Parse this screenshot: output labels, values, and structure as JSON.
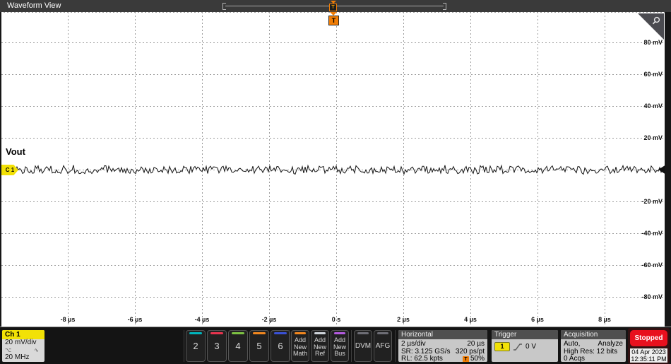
{
  "window": {
    "title": "Waveform View"
  },
  "colors": {
    "accent_orange": "#f07d05",
    "channel_yellow": "#f2e106",
    "stopped_red": "#e8101e",
    "grid_line": "#9b9b9b",
    "trace": "#141414"
  },
  "graticule": {
    "y_labels": [
      "80 mV",
      "60 mV",
      "40 mV",
      "20 mV",
      "-20 mV",
      "-40 mV",
      "-60 mV",
      "-80 mV"
    ],
    "x_labels": [
      "-8 µs",
      "-6 µs",
      "-4 µs",
      "-2 µs",
      "0 s",
      "2 µs",
      "4 µs",
      "6 µs",
      "8 µs"
    ],
    "volts_per_div": "20 mV/div",
    "time_per_div": "2 µs/div"
  },
  "waveform": {
    "label": "Vout",
    "channel_badge": "C 1",
    "mean_mv": 0,
    "noise_pp_mv": 5,
    "x_range_us": [
      -10,
      10
    ],
    "y_range_mv": [
      -100,
      100
    ]
  },
  "markers": {
    "minimap_trigger": "T",
    "trigger_flag": "T"
  },
  "icons": {
    "zoom_glass": "magnifier",
    "probe": "⌥",
    "sine": "∿",
    "small_badge": "◆"
  },
  "toolbar": {
    "ch1": {
      "label": "Ch 1",
      "scale": "20 mV/div",
      "bandwidth": "20 MHz"
    },
    "channels": [
      {
        "label": "2",
        "color": "#00b5bd"
      },
      {
        "label": "3",
        "color": "#e8344e"
      },
      {
        "label": "4",
        "color": "#7dc242"
      },
      {
        "label": "5",
        "color": "#f1871f"
      },
      {
        "label": "6",
        "color": "#3a51d6"
      }
    ],
    "add_buttons": [
      {
        "lines": [
          "Add",
          "New",
          "Math"
        ],
        "color": "#f1871f"
      },
      {
        "lines": [
          "Add",
          "New",
          "Ref"
        ],
        "color": "#cfd4da"
      },
      {
        "lines": [
          "Add",
          "New",
          "Bus"
        ],
        "color": "#b45be0"
      }
    ],
    "utility_buttons": [
      "DVM",
      "AFG"
    ],
    "horizontal": {
      "header": "Horizontal",
      "row1_left": "2 µs/div",
      "row1_right": "20 µs",
      "row2_left": "SR: 3.125 GS/s",
      "row2_right": "320 ps/pt",
      "row3_left": "RL: 62.5 kpts",
      "row3_right": "50%",
      "trigger_pos_icon": "T"
    },
    "trigger": {
      "header": "Trigger",
      "source": "1",
      "level": "0 V"
    },
    "acquisition": {
      "header": "Acquisition",
      "row1_left": "Auto,",
      "row1_right": "Analyze",
      "row2": "High Res: 12 bits",
      "row3": "0 Acqs"
    },
    "run_state": "Stopped",
    "date": "04 Apr 2023",
    "time": "12:35:11 PM"
  }
}
